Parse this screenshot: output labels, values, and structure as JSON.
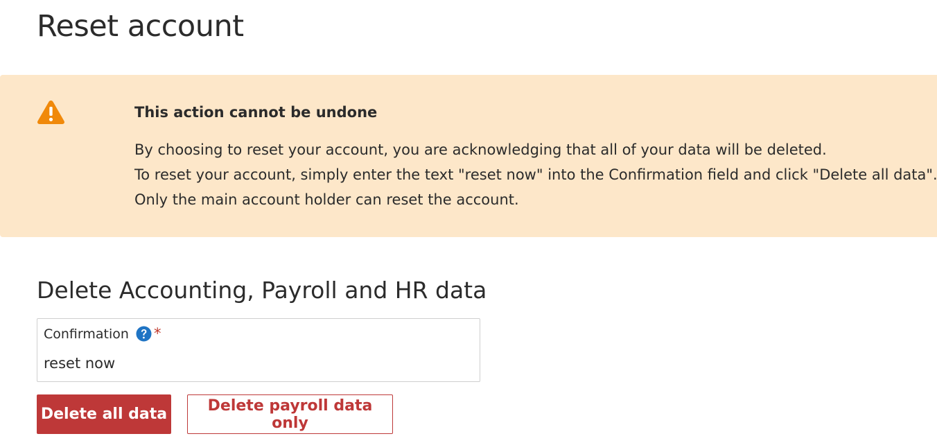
{
  "page": {
    "title": "Reset account"
  },
  "warning": {
    "icon": "warning-triangle-icon",
    "color": "#f0890a",
    "background": "#fde7c9",
    "heading": "This action cannot be undone",
    "lines": [
      "By choosing to reset your account, you are acknowledging that all of your data will be deleted.",
      "To reset your account, simply enter the text \"reset now\" into the Confirmation field and click \"Delete all data\".",
      "Only the main account holder can reset the account."
    ]
  },
  "section": {
    "title": "Delete Accounting, Payroll and HR data"
  },
  "confirmation": {
    "label": "Confirmation",
    "help_icon": "question-circle-icon",
    "required_marker": "*",
    "value": "reset now"
  },
  "actions": {
    "delete_all_label": "Delete all data",
    "delete_payroll_label": "Delete payroll data only",
    "danger_color": "#be3838"
  }
}
